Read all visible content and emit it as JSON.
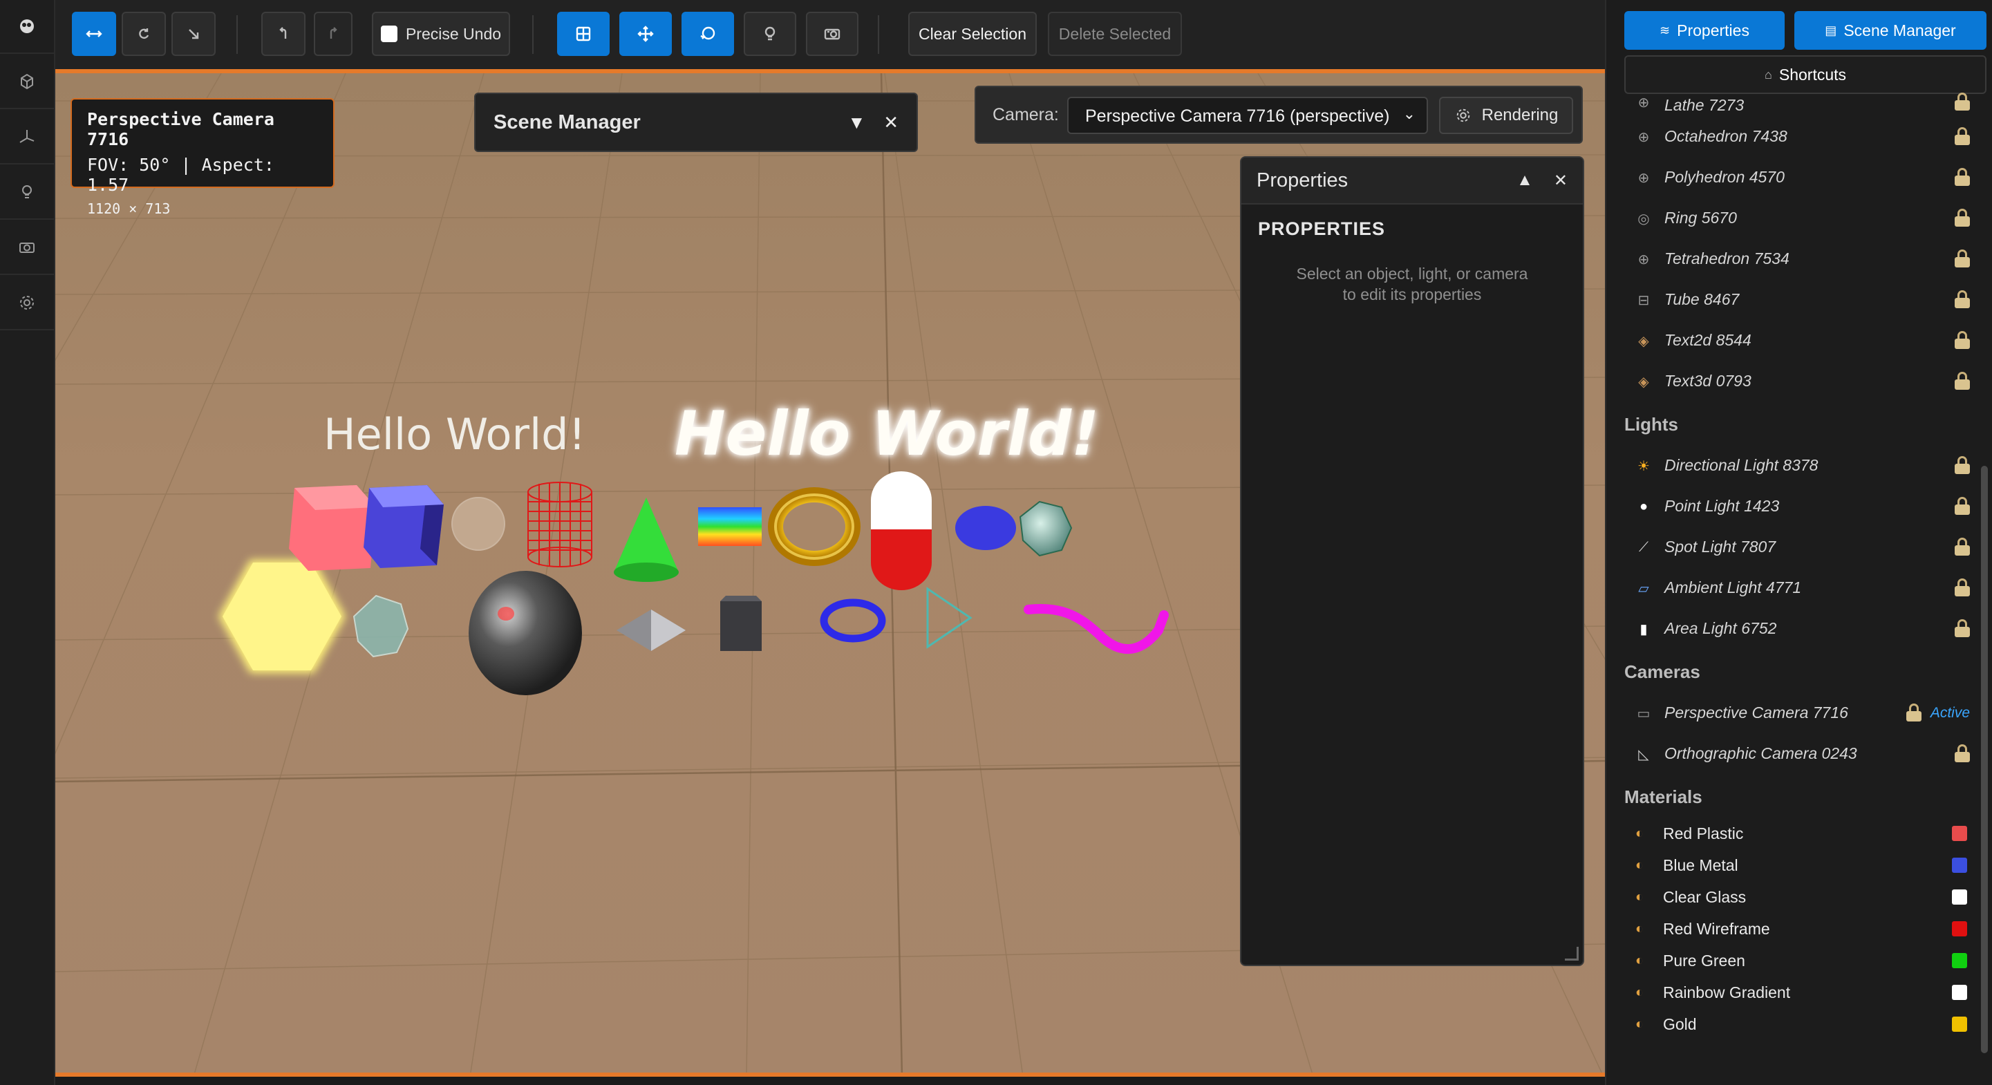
{
  "toolbar": {
    "precise_undo_label": "Precise Undo",
    "clear_selection_label": "Clear Selection",
    "delete_selected_label": "Delete Selected"
  },
  "camera_info": {
    "name": "Perspective Camera 7716",
    "fov_line": "FOV: 50° | Aspect: 1.57",
    "resolution": "1120 × 713"
  },
  "scene_manager_panel": {
    "title": "Scene Manager"
  },
  "camera_selector": {
    "label": "Camera:",
    "selected": "Perspective Camera 7716 (perspective)",
    "rendering_label": "Rendering"
  },
  "properties_panel": {
    "title": "Properties",
    "heading": "PROPERTIES",
    "empty_line1": "Select an object, light, or camera",
    "empty_line2": "to edit its properties"
  },
  "viewport": {
    "text_flat": "Hello World!",
    "text_3d": "Hello World!"
  },
  "sidebar": {
    "properties_tab": "Properties",
    "scene_manager_tab": "Scene Manager",
    "shortcuts_label": "Shortcuts",
    "objects": [
      {
        "label": "Lathe 7273",
        "icon": "lathe-icon"
      },
      {
        "label": "Octahedron 7438",
        "icon": "globe-icon"
      },
      {
        "label": "Polyhedron 4570",
        "icon": "globe-icon"
      },
      {
        "label": "Ring 5670",
        "icon": "ring-icon"
      },
      {
        "label": "Tetrahedron 7534",
        "icon": "globe-icon"
      },
      {
        "label": "Tube 8467",
        "icon": "tube-icon"
      },
      {
        "label": "Text2d 8544",
        "icon": "box-icon"
      },
      {
        "label": "Text3d 0793",
        "icon": "box-icon"
      }
    ],
    "lights_title": "Lights",
    "lights": [
      {
        "label": "Directional Light 8378",
        "icon": "sun-icon"
      },
      {
        "label": "Point Light 1423",
        "icon": "bulb-icon"
      },
      {
        "label": "Spot Light 7807",
        "icon": "spotlight-icon"
      },
      {
        "label": "Ambient Light 4771",
        "icon": "ambient-icon"
      },
      {
        "label": "Area Light 6752",
        "icon": "area-light-icon"
      }
    ],
    "cameras_title": "Cameras",
    "cameras": [
      {
        "label": "Perspective Camera 7716",
        "icon": "camera-icon",
        "badge": "Active"
      },
      {
        "label": "Orthographic Camera 0243",
        "icon": "ortho-camera-icon"
      }
    ],
    "materials_title": "Materials",
    "materials": [
      {
        "label": "Red Plastic",
        "color": "#e84c4c"
      },
      {
        "label": "Blue Metal",
        "color": "#3b4fe0"
      },
      {
        "label": "Clear Glass",
        "color": "#ffffff"
      },
      {
        "label": "Red Wireframe",
        "color": "#e01010"
      },
      {
        "label": "Pure Green",
        "color": "#10d010"
      },
      {
        "label": "Rainbow Gradient",
        "color": "#ffffff"
      },
      {
        "label": "Gold",
        "color": "#f0c000"
      }
    ]
  },
  "colors": {
    "accent": "#0a78d6",
    "viewport_border": "#e67a2a",
    "active_badge": "#3aa6ff"
  }
}
